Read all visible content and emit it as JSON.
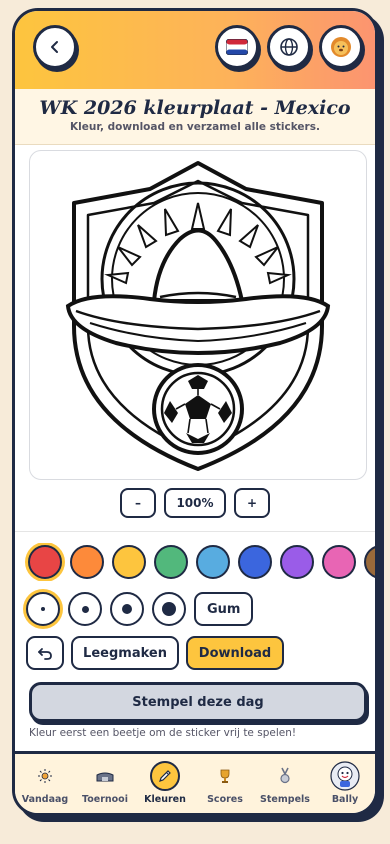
{
  "header": {
    "title": "WK 2026 kleurplaat - Mexico",
    "subtitle": "Kleur, download en verzamel alle stickers.",
    "back_icon": "chevron-left-icon",
    "buttons": [
      {
        "name": "language-nl-button",
        "icon": "netherlands-flag-icon"
      },
      {
        "name": "globe-button",
        "icon": "globe-icon"
      },
      {
        "name": "mascot-button",
        "icon": "lion-mascot-icon"
      }
    ]
  },
  "zoom": {
    "minus_label": "–",
    "value": "100%",
    "plus_label": "+"
  },
  "palette": {
    "colors": [
      "#e84545",
      "#fd8a3a",
      "#fdc53e",
      "#52b87c",
      "#58ace0",
      "#3b66de",
      "#9a5ce8",
      "#e865b4",
      "#9a6a3a"
    ],
    "selected_index": 0
  },
  "brushes": {
    "selected_index": 0,
    "eraser_label": "Gum"
  },
  "actions": {
    "undo_icon": "undo-icon",
    "clear_label": "Leegmaken",
    "download_label": "Download"
  },
  "stamp": {
    "button_label": "Stempel deze dag",
    "hint": "Kleur eerst een beetje om de sticker vrij te spelen!"
  },
  "nav": {
    "items": [
      {
        "label": "Vandaag",
        "icon": "sun-icon"
      },
      {
        "label": "Toernooi",
        "icon": "stadium-icon"
      },
      {
        "label": "Kleuren",
        "icon": "pencil-icon",
        "active": true
      },
      {
        "label": "Scores",
        "icon": "trophy-icon"
      },
      {
        "label": "Stempels",
        "icon": "medal-icon"
      },
      {
        "label": "Bally",
        "icon": "bally-mascot-icon"
      }
    ]
  }
}
